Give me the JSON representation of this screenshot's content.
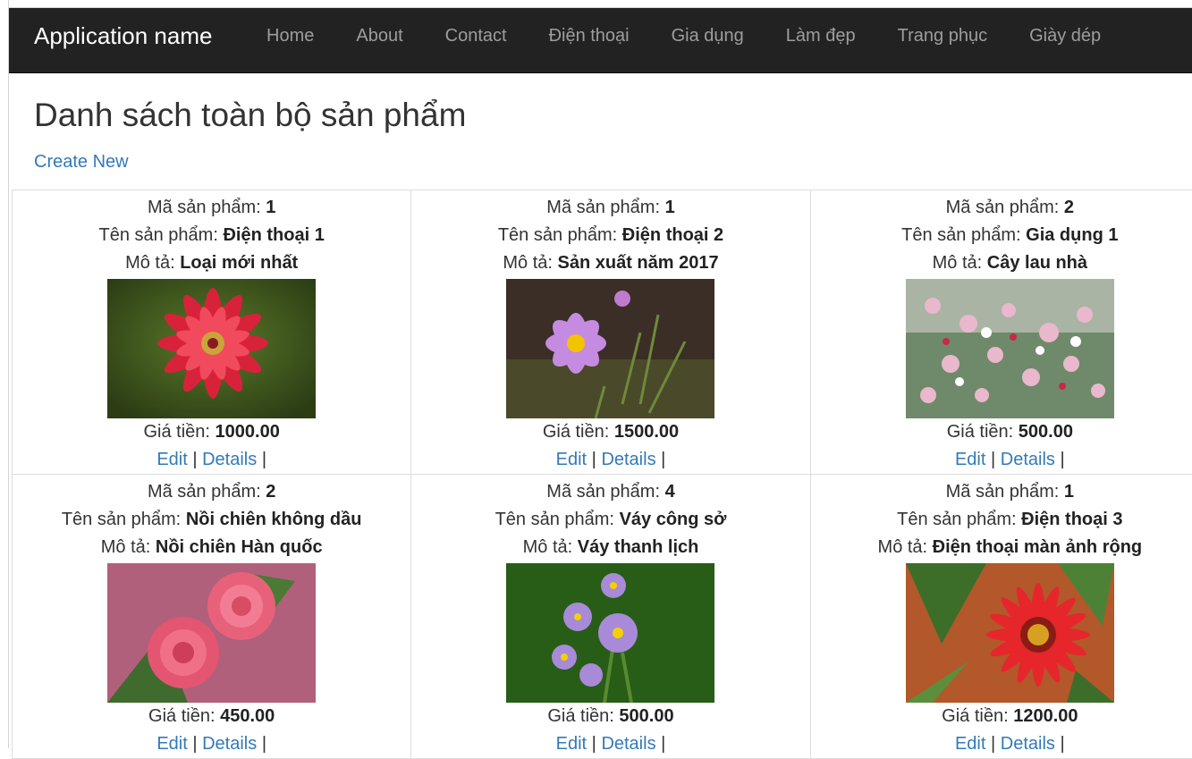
{
  "navbar": {
    "brand": "Application name",
    "items": [
      "Home",
      "About",
      "Contact",
      "Điện thoại",
      "Gia dụng",
      "Làm đẹp",
      "Trang phục",
      "Giày dép"
    ]
  },
  "page": {
    "title": "Danh sách toàn bộ sản phẩm",
    "create_label": "Create New"
  },
  "labels": {
    "code": "Mã sản phẩm:",
    "name": "Tên sản phẩm:",
    "desc": "Mô tả:",
    "price": "Giá tiền:",
    "edit": "Edit",
    "details": "Details",
    "sep": "|"
  },
  "products": [
    {
      "code": "1",
      "name": "Điện thoại 1",
      "desc": "Loại mới nhất",
      "price": "1000.00",
      "image": "red-dahlia-flower"
    },
    {
      "code": "1",
      "name": "Điện thoại 2",
      "desc": "Sản xuất năm 2017",
      "price": "1500.00",
      "image": "pink-cosmos-flower"
    },
    {
      "code": "2",
      "name": "Gia dụng 1",
      "desc": "Cây lau nhà",
      "price": "500.00",
      "image": "small-pink-white-flowers"
    },
    {
      "code": "2",
      "name": "Nồi chiên không dầu",
      "desc": "Nồi chiên Hàn quốc",
      "price": "450.00",
      "image": "pink-roses"
    },
    {
      "code": "4",
      "name": "Váy công sở",
      "desc": "Váy thanh lịch",
      "price": "500.00",
      "image": "purple-potato-flowers"
    },
    {
      "code": "1",
      "name": "Điện thoại 3",
      "desc": "Điện thoại màn ảnh rộng",
      "price": "1200.00",
      "image": "red-gerbera-flower"
    }
  ]
}
